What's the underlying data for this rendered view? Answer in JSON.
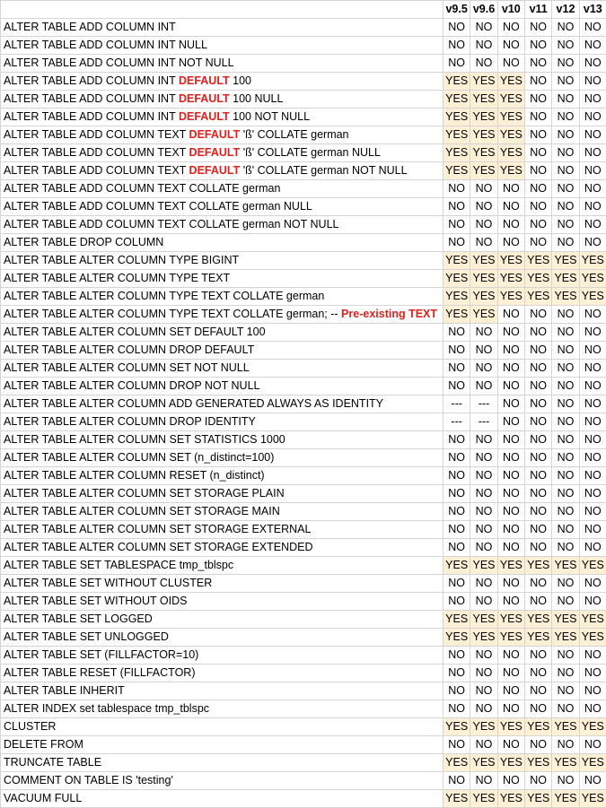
{
  "header": {
    "versions": [
      "v9.5",
      "v9.6",
      "v10",
      "v11",
      "v12",
      "v13"
    ]
  },
  "rows": [
    {
      "parts": [
        {
          "t": "ALTER TABLE ADD COLUMN INT"
        }
      ],
      "vals": [
        "NO",
        "NO",
        "NO",
        "NO",
        "NO",
        "NO"
      ]
    },
    {
      "parts": [
        {
          "t": "ALTER TABLE ADD COLUMN INT NULL"
        }
      ],
      "vals": [
        "NO",
        "NO",
        "NO",
        "NO",
        "NO",
        "NO"
      ]
    },
    {
      "parts": [
        {
          "t": "ALTER TABLE ADD COLUMN INT NOT NULL"
        }
      ],
      "vals": [
        "NO",
        "NO",
        "NO",
        "NO",
        "NO",
        "NO"
      ]
    },
    {
      "parts": [
        {
          "t": "ALTER TABLE ADD COLUMN INT "
        },
        {
          "t": "DEFAULT",
          "hl": true
        },
        {
          "t": " 100"
        }
      ],
      "vals": [
        "YES",
        "YES",
        "YES",
        "NO",
        "NO",
        "NO"
      ]
    },
    {
      "parts": [
        {
          "t": "ALTER TABLE ADD COLUMN INT "
        },
        {
          "t": "DEFAULT",
          "hl": true
        },
        {
          "t": " 100 NULL"
        }
      ],
      "vals": [
        "YES",
        "YES",
        "YES",
        "NO",
        "NO",
        "NO"
      ]
    },
    {
      "parts": [
        {
          "t": "ALTER TABLE ADD COLUMN INT "
        },
        {
          "t": "DEFAULT",
          "hl": true
        },
        {
          "t": " 100 NOT NULL"
        }
      ],
      "vals": [
        "YES",
        "YES",
        "YES",
        "NO",
        "NO",
        "NO"
      ]
    },
    {
      "parts": [
        {
          "t": "ALTER TABLE ADD COLUMN TEXT "
        },
        {
          "t": "DEFAULT",
          "hl": true
        },
        {
          "t": " 'ß' COLLATE german"
        }
      ],
      "vals": [
        "YES",
        "YES",
        "YES",
        "NO",
        "NO",
        "NO"
      ]
    },
    {
      "parts": [
        {
          "t": "ALTER TABLE ADD COLUMN TEXT "
        },
        {
          "t": "DEFAULT",
          "hl": true
        },
        {
          "t": " 'ß' COLLATE german NULL"
        }
      ],
      "vals": [
        "YES",
        "YES",
        "YES",
        "NO",
        "NO",
        "NO"
      ]
    },
    {
      "parts": [
        {
          "t": "ALTER TABLE ADD COLUMN TEXT "
        },
        {
          "t": "DEFAULT",
          "hl": true
        },
        {
          "t": " 'ß' COLLATE german NOT NULL"
        }
      ],
      "vals": [
        "YES",
        "YES",
        "YES",
        "NO",
        "NO",
        "NO"
      ]
    },
    {
      "parts": [
        {
          "t": "ALTER TABLE ADD COLUMN TEXT COLLATE german"
        }
      ],
      "vals": [
        "NO",
        "NO",
        "NO",
        "NO",
        "NO",
        "NO"
      ]
    },
    {
      "parts": [
        {
          "t": "ALTER TABLE ADD COLUMN TEXT COLLATE german NULL"
        }
      ],
      "vals": [
        "NO",
        "NO",
        "NO",
        "NO",
        "NO",
        "NO"
      ]
    },
    {
      "parts": [
        {
          "t": "ALTER TABLE ADD COLUMN TEXT COLLATE german NOT NULL"
        }
      ],
      "vals": [
        "NO",
        "NO",
        "NO",
        "NO",
        "NO",
        "NO"
      ]
    },
    {
      "parts": [
        {
          "t": "ALTER TABLE DROP COLUMN"
        }
      ],
      "vals": [
        "NO",
        "NO",
        "NO",
        "NO",
        "NO",
        "NO"
      ]
    },
    {
      "parts": [
        {
          "t": "ALTER TABLE ALTER COLUMN TYPE BIGINT"
        }
      ],
      "vals": [
        "YES",
        "YES",
        "YES",
        "YES",
        "YES",
        "YES"
      ]
    },
    {
      "parts": [
        {
          "t": "ALTER TABLE ALTER COLUMN TYPE TEXT"
        }
      ],
      "vals": [
        "YES",
        "YES",
        "YES",
        "YES",
        "YES",
        "YES"
      ]
    },
    {
      "parts": [
        {
          "t": "ALTER TABLE ALTER COLUMN TYPE TEXT COLLATE german"
        }
      ],
      "vals": [
        "YES",
        "YES",
        "YES",
        "YES",
        "YES",
        "YES"
      ]
    },
    {
      "parts": [
        {
          "t": "ALTER TABLE ALTER COLUMN TYPE TEXT COLLATE german; -- "
        },
        {
          "t": "Pre-existing TEXT",
          "hl": true
        }
      ],
      "vals": [
        "YES",
        "YES",
        "NO",
        "NO",
        "NO",
        "NO"
      ]
    },
    {
      "parts": [
        {
          "t": "ALTER TABLE ALTER COLUMN SET DEFAULT 100"
        }
      ],
      "vals": [
        "NO",
        "NO",
        "NO",
        "NO",
        "NO",
        "NO"
      ]
    },
    {
      "parts": [
        {
          "t": "ALTER TABLE ALTER COLUMN DROP DEFAULT"
        }
      ],
      "vals": [
        "NO",
        "NO",
        "NO",
        "NO",
        "NO",
        "NO"
      ]
    },
    {
      "parts": [
        {
          "t": "ALTER TABLE ALTER COLUMN SET NOT NULL"
        }
      ],
      "vals": [
        "NO",
        "NO",
        "NO",
        "NO",
        "NO",
        "NO"
      ]
    },
    {
      "parts": [
        {
          "t": "ALTER TABLE ALTER COLUMN DROP NOT NULL"
        }
      ],
      "vals": [
        "NO",
        "NO",
        "NO",
        "NO",
        "NO",
        "NO"
      ]
    },
    {
      "parts": [
        {
          "t": "ALTER TABLE ALTER COLUMN ADD GENERATED ALWAYS AS IDENTITY"
        }
      ],
      "vals": [
        "---",
        "---",
        "NO",
        "NO",
        "NO",
        "NO"
      ]
    },
    {
      "parts": [
        {
          "t": "ALTER TABLE ALTER COLUMN DROP IDENTITY"
        }
      ],
      "vals": [
        "---",
        "---",
        "NO",
        "NO",
        "NO",
        "NO"
      ]
    },
    {
      "parts": [
        {
          "t": "ALTER TABLE ALTER COLUMN SET STATISTICS 1000"
        }
      ],
      "vals": [
        "NO",
        "NO",
        "NO",
        "NO",
        "NO",
        "NO"
      ]
    },
    {
      "parts": [
        {
          "t": "ALTER TABLE ALTER COLUMN SET (n_distinct=100)"
        }
      ],
      "vals": [
        "NO",
        "NO",
        "NO",
        "NO",
        "NO",
        "NO"
      ]
    },
    {
      "parts": [
        {
          "t": "ALTER TABLE ALTER COLUMN RESET (n_distinct)"
        }
      ],
      "vals": [
        "NO",
        "NO",
        "NO",
        "NO",
        "NO",
        "NO"
      ]
    },
    {
      "parts": [
        {
          "t": "ALTER TABLE ALTER COLUMN SET STORAGE PLAIN"
        }
      ],
      "vals": [
        "NO",
        "NO",
        "NO",
        "NO",
        "NO",
        "NO"
      ]
    },
    {
      "parts": [
        {
          "t": "ALTER TABLE ALTER COLUMN SET STORAGE MAIN"
        }
      ],
      "vals": [
        "NO",
        "NO",
        "NO",
        "NO",
        "NO",
        "NO"
      ]
    },
    {
      "parts": [
        {
          "t": "ALTER TABLE ALTER COLUMN SET STORAGE EXTERNAL"
        }
      ],
      "vals": [
        "NO",
        "NO",
        "NO",
        "NO",
        "NO",
        "NO"
      ]
    },
    {
      "parts": [
        {
          "t": "ALTER TABLE ALTER COLUMN SET STORAGE EXTENDED"
        }
      ],
      "vals": [
        "NO",
        "NO",
        "NO",
        "NO",
        "NO",
        "NO"
      ]
    },
    {
      "parts": [
        {
          "t": "ALTER TABLE SET TABLESPACE tmp_tblspc"
        }
      ],
      "vals": [
        "YES",
        "YES",
        "YES",
        "YES",
        "YES",
        "YES"
      ]
    },
    {
      "parts": [
        {
          "t": "ALTER TABLE SET WITHOUT CLUSTER"
        }
      ],
      "vals": [
        "NO",
        "NO",
        "NO",
        "NO",
        "NO",
        "NO"
      ]
    },
    {
      "parts": [
        {
          "t": "ALTER TABLE SET WITHOUT OIDS"
        }
      ],
      "vals": [
        "NO",
        "NO",
        "NO",
        "NO",
        "NO",
        "NO"
      ]
    },
    {
      "parts": [
        {
          "t": "ALTER TABLE SET LOGGED"
        }
      ],
      "vals": [
        "YES",
        "YES",
        "YES",
        "YES",
        "YES",
        "YES"
      ]
    },
    {
      "parts": [
        {
          "t": "ALTER TABLE SET UNLOGGED"
        }
      ],
      "vals": [
        "YES",
        "YES",
        "YES",
        "YES",
        "YES",
        "YES"
      ]
    },
    {
      "parts": [
        {
          "t": "ALTER TABLE SET (FILLFACTOR=10)"
        }
      ],
      "vals": [
        "NO",
        "NO",
        "NO",
        "NO",
        "NO",
        "NO"
      ]
    },
    {
      "parts": [
        {
          "t": "ALTER TABLE RESET (FILLFACTOR)"
        }
      ],
      "vals": [
        "NO",
        "NO",
        "NO",
        "NO",
        "NO",
        "NO"
      ]
    },
    {
      "parts": [
        {
          "t": "ALTER TABLE INHERIT"
        }
      ],
      "vals": [
        "NO",
        "NO",
        "NO",
        "NO",
        "NO",
        "NO"
      ]
    },
    {
      "parts": [
        {
          "t": "ALTER INDEX set tablespace tmp_tblspc"
        }
      ],
      "vals": [
        "NO",
        "NO",
        "NO",
        "NO",
        "NO",
        "NO"
      ]
    },
    {
      "parts": [
        {
          "t": "CLUSTER"
        }
      ],
      "vals": [
        "YES",
        "YES",
        "YES",
        "YES",
        "YES",
        "YES"
      ]
    },
    {
      "parts": [
        {
          "t": "DELETE FROM"
        }
      ],
      "vals": [
        "NO",
        "NO",
        "NO",
        "NO",
        "NO",
        "NO"
      ]
    },
    {
      "parts": [
        {
          "t": "TRUNCATE TABLE"
        }
      ],
      "vals": [
        "YES",
        "YES",
        "YES",
        "YES",
        "YES",
        "YES"
      ]
    },
    {
      "parts": [
        {
          "t": "COMMENT ON TABLE IS 'testing'"
        }
      ],
      "vals": [
        "NO",
        "NO",
        "NO",
        "NO",
        "NO",
        "NO"
      ]
    },
    {
      "parts": [
        {
          "t": "VACUUM FULL"
        }
      ],
      "vals": [
        "YES",
        "YES",
        "YES",
        "YES",
        "YES",
        "YES"
      ]
    }
  ],
  "colors": {
    "highlight_text": "#e0201b",
    "yes_fill": "#fdf0d4",
    "grid": "#d4d4d4"
  }
}
